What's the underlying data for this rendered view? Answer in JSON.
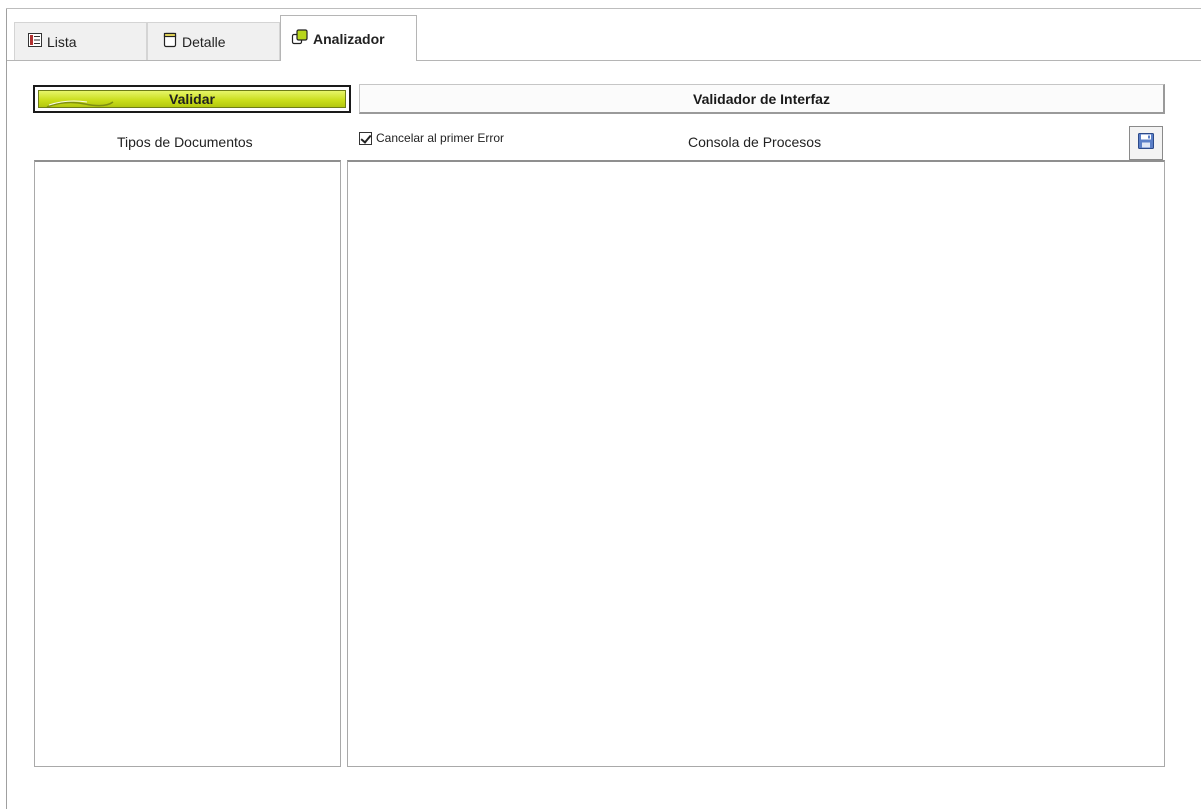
{
  "tabs": [
    {
      "label": "Lista",
      "icon": "list-icon",
      "active": false
    },
    {
      "label": "Detalle",
      "icon": "form-icon",
      "active": false
    },
    {
      "label": "Analizador",
      "icon": "analyzer-icon",
      "active": true
    }
  ],
  "toolbar": {
    "validar_label": "Validar",
    "header_title": "Validador de Interfaz",
    "save_icon": "save-icon"
  },
  "document_types": {
    "label": "Tipos de Documentos"
  },
  "options": {
    "cancel_on_first_error_label": "Cancelar al primer Error",
    "cancel_on_first_error_checked": true
  },
  "console": {
    "label": "Consola de Procesos"
  },
  "colors": {
    "validar_accent": "#c9dd19",
    "panel_border": "#a9a9a9",
    "save_icon_blue": "#5b7fc7"
  }
}
